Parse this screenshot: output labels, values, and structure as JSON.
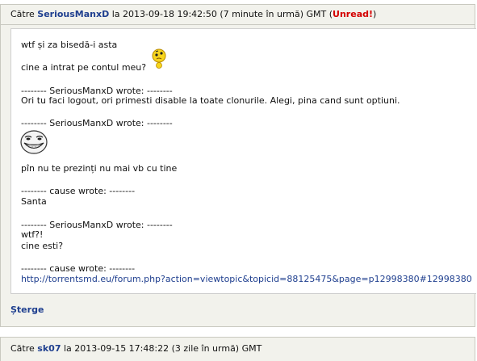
{
  "message1": {
    "to_prefix": "Către",
    "sender": "SeriousManxD",
    "date_text": "la 2013-09-18 19:42:50 (7 minute în urmă) GMT",
    "unread_open": "(",
    "unread_label": "Unread!",
    "unread_close": ")",
    "lines": {
      "l1": "wtf și za bisedă-i asta",
      "l2": "cine a intrat pe contul meu?",
      "l3": "-------- SeriousManxD wrote: --------",
      "l4": "Ori tu faci logout, ori primesti disable la toate clonurile. Alegi, pina cand sunt optiuni.",
      "l5": "-------- SeriousManxD wrote: --------",
      "l6": "pîn nu te prezinți nu mai vb cu tine",
      "l7": "-------- cause wrote: --------",
      "l8": "Santa",
      "l9": "-------- SeriousManxD wrote: --------",
      "l10": "wtf?!",
      "l11": "cine esti?",
      "l12": "-------- cause wrote: --------"
    },
    "link_url": "http://torrentsmd.eu/forum.php?action=viewtopic&topicid=88125475&page=p12998380#12998380",
    "delete_label": "Șterge",
    "icons": [
      "thinking-emoji-icon",
      "troll-face-icon"
    ]
  },
  "message2": {
    "to_prefix": "Către",
    "sender": "sk07",
    "date_text": "la 2013-09-15 17:48:22 (3 zile în urmă) GMT"
  },
  "colors": {
    "link": "#1f3f8f",
    "unread": "#d40000",
    "panel_bg": "#f2f2ec",
    "border": "#c9c9c0"
  }
}
